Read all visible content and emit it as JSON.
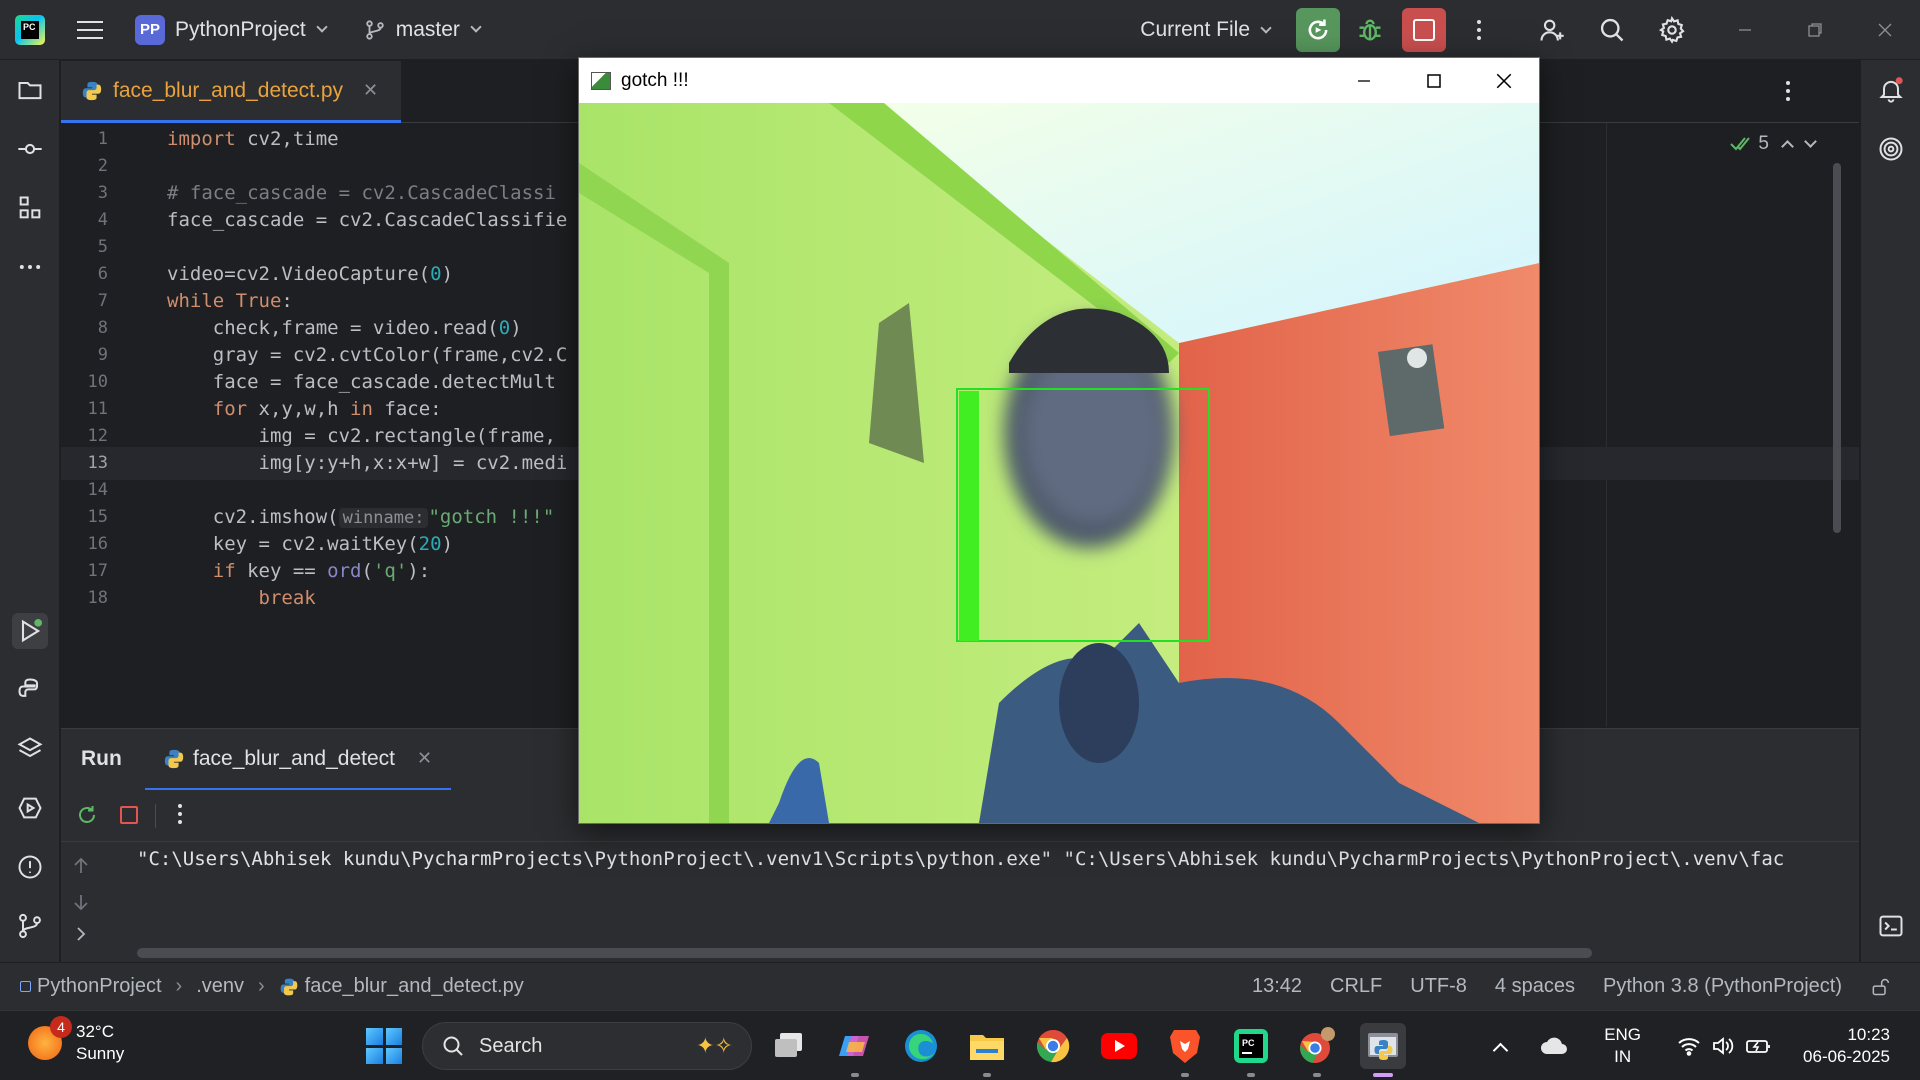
{
  "titlebar": {
    "project_badge": "PP",
    "project_name": "PythonProject",
    "branch": "master",
    "run_config": "Current File"
  },
  "editor": {
    "tab_label": "face_blur_and_detect.py",
    "inspection_count": "5",
    "lines": [
      {
        "n": "1"
      },
      {
        "n": "2"
      },
      {
        "n": "3"
      },
      {
        "n": "4"
      },
      {
        "n": "5"
      },
      {
        "n": "6"
      },
      {
        "n": "7"
      },
      {
        "n": "8"
      },
      {
        "n": "9"
      },
      {
        "n": "10"
      },
      {
        "n": "11"
      },
      {
        "n": "12"
      },
      {
        "n": "13"
      },
      {
        "n": "14"
      },
      {
        "n": "15"
      },
      {
        "n": "16"
      },
      {
        "n": "17"
      },
      {
        "n": "18"
      }
    ],
    "code": {
      "l1_kw": "import",
      "l1_rest": " cv2,time",
      "l3": "# face_cascade = cv2.CascadeClassi",
      "l4": "face_cascade = cv2.CascadeClassifie",
      "l6_a": "video=cv2.VideoCapture(",
      "l6_num": "0",
      "l6_b": ")",
      "l7_kw1": "while",
      "l7_kw2": " True",
      "l7_b": ":",
      "l8_a": "    check,frame = video.read(",
      "l8_num": "0",
      "l8_b": ")",
      "l9": "    gray = cv2.cvtColor(frame,cv2.C",
      "l10": "    face = face_cascade.detectMult",
      "l11_indent": "    ",
      "l11_kw": "for",
      "l11_b": " x,y,w,h ",
      "l11_kw2": "in",
      "l11_c": " face:",
      "l12": "        img = cv2.rectangle(frame,",
      "l13": "        img[y:y+h,x:x+w] = cv2.medi",
      "l15_a": "    cv2.imshow(",
      "l15_param": "winname:",
      "l15_str": "\"gotch !!!\"",
      "l16_a": "    key = cv2.waitKey(",
      "l16_num": "20",
      "l16_b": ")",
      "l17_indent": "    ",
      "l17_kw": "if",
      "l17_b": " key == ",
      "l17_fn": "ord",
      "l17_c": "(",
      "l17_str": "'q'",
      "l17_d": "):",
      "l18_indent": "        ",
      "l18_kw": "break"
    }
  },
  "cv_window": {
    "title": "gotch !!!"
  },
  "run_panel": {
    "title": "Run",
    "tab_label": "face_blur_and_detect",
    "console_line": "\"C:\\Users\\Abhisek kundu\\PycharmProjects\\PythonProject\\.venv1\\Scripts\\python.exe\" \"C:\\Users\\Abhisek kundu\\PycharmProjects\\PythonProject\\.venv\\fac"
  },
  "statusbar": {
    "crumb_project": "PythonProject",
    "crumb_venv": ".venv",
    "crumb_file": "face_blur_and_detect.py",
    "position": "13:42",
    "line_ending": "CRLF",
    "encoding": "UTF-8",
    "indent": "4 spaces",
    "interpreter": "Python 3.8 (PythonProject)"
  },
  "taskbar": {
    "weather_temp": "32°C",
    "weather_cond": "Sunny",
    "weather_badge": "4",
    "search_placeholder": "Search",
    "lang_top": "ENG",
    "lang_bottom": "IN",
    "time": "10:23",
    "date": "06-06-2025"
  }
}
